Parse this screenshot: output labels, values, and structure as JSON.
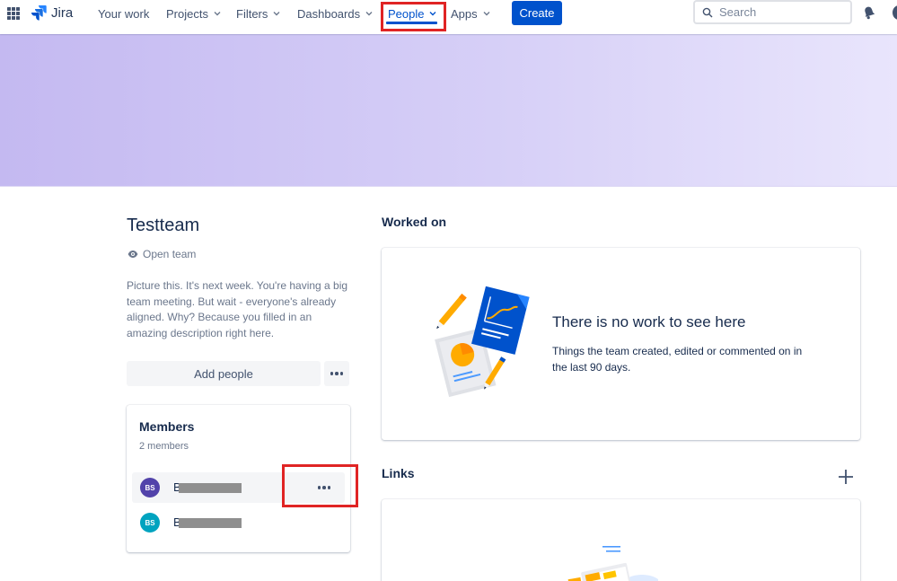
{
  "nav": {
    "logo_text": "Jira",
    "items": [
      {
        "label": "Your work",
        "has_chevron": false
      },
      {
        "label": "Projects",
        "has_chevron": true
      },
      {
        "label": "Filters",
        "has_chevron": true
      },
      {
        "label": "Dashboards",
        "has_chevron": true
      },
      {
        "label": "People",
        "has_chevron": true,
        "active": true
      },
      {
        "label": "Apps",
        "has_chevron": true
      }
    ],
    "create_label": "Create",
    "search_placeholder": "Search"
  },
  "team": {
    "name": "Testteam",
    "visibility": "Open team",
    "description": "Picture this. It's next week. You're having a big team meeting. But wait - everyone's already aligned. Why? Because you filled in an amazing description right here.",
    "add_people_label": "Add people"
  },
  "members": {
    "title": "Members",
    "count_text": "2 members",
    "list": [
      {
        "initials": "BS",
        "name_prefix": "B",
        "avatar_color": "#5243aa"
      },
      {
        "initials": "BS",
        "name_prefix": "B",
        "avatar_color": "#00a3bf"
      }
    ]
  },
  "worked_on": {
    "title": "Worked on",
    "empty_title": "There is no work to see here",
    "empty_subtitle": "Things the team created, edited or commented on in the last 90 days."
  },
  "links": {
    "title": "Links"
  },
  "colors": {
    "brand": "#0052cc",
    "highlight": "#e02424",
    "banner_start": "#c4b9f1",
    "banner_end": "#e9e5fc"
  }
}
